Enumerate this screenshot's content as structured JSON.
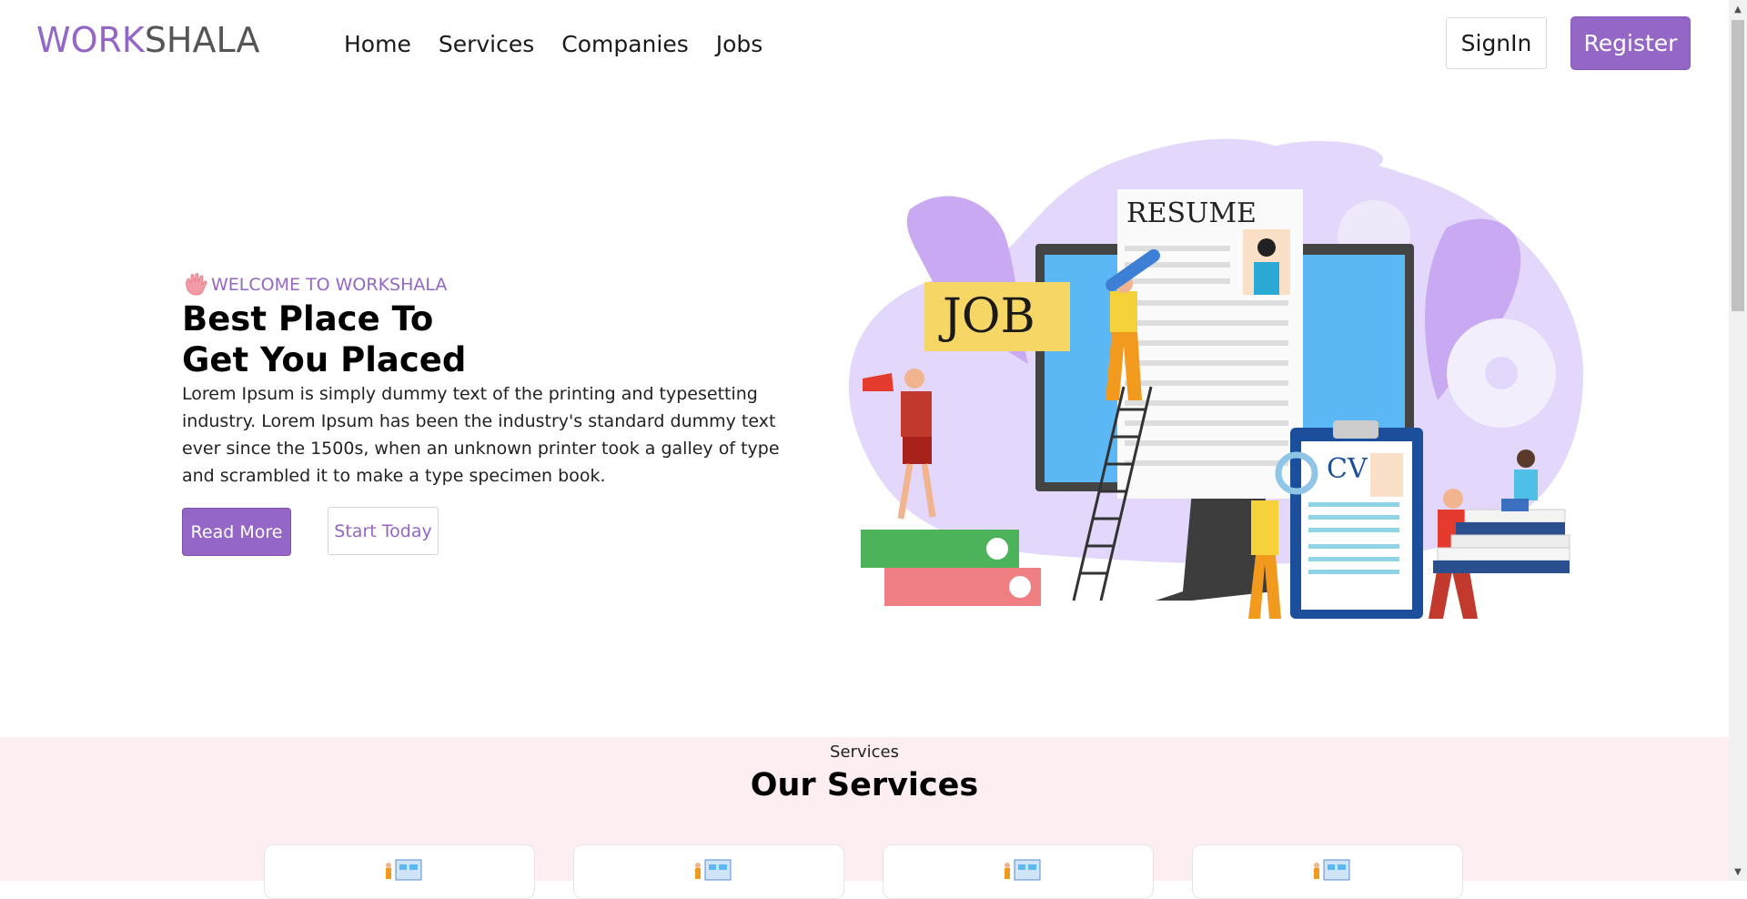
{
  "brand": {
    "part1": "WORK",
    "part2": "SHALA",
    "color_primary": "#9466c5",
    "color_secondary": "#555555"
  },
  "nav": {
    "items": [
      "Home",
      "Services",
      "Companies",
      "Jobs"
    ]
  },
  "auth": {
    "signin_label": "SignIn",
    "register_label": "Register"
  },
  "hero": {
    "welcome_label": "WELCOME TO WORKSHALA",
    "title_line1": "Best Place To",
    "title_line2": "Get You Placed",
    "description": "Lorem Ipsum is simply dummy text of the printing and typesetting industry. Lorem Ipsum has been the industry's standard dummy text ever since the 1500s, when an unknown printer took a galley of type and scrambled it to make a type specimen book.",
    "read_more_label": "Read More",
    "start_today_label": "Start Today",
    "illustration": {
      "job_sign": "JOB",
      "resume_label": "RESUME",
      "cv_label": "CV"
    }
  },
  "services": {
    "kicker": "Services",
    "title": "Our Services",
    "cards_count_visible": 4
  },
  "colors": {
    "accent": "#9466c5",
    "services_bg": "#fdeef1"
  }
}
